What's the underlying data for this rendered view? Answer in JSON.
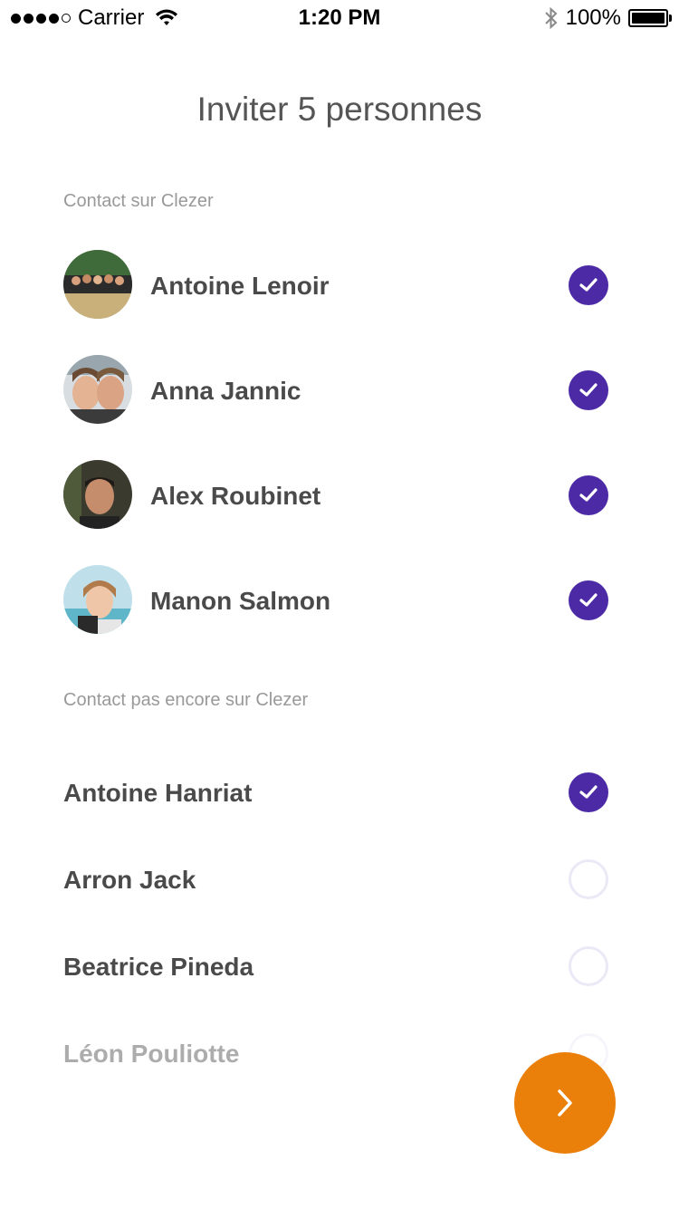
{
  "status": {
    "carrier": "Carrier",
    "time": "1:20 PM",
    "battery": "100%"
  },
  "title": "Inviter 5 personnes",
  "sections": {
    "on_app": "Contact sur Clezer",
    "not_on_app": "Contact pas encore sur Clezer"
  },
  "contacts_on_app": [
    {
      "name": "Antoine Lenoir",
      "selected": true
    },
    {
      "name": "Anna Jannic",
      "selected": true
    },
    {
      "name": "Alex Roubinet",
      "selected": true
    },
    {
      "name": "Manon Salmon",
      "selected": true
    }
  ],
  "contacts_not_on_app": [
    {
      "name": "Antoine Hanriat",
      "selected": true
    },
    {
      "name": "Arron Jack",
      "selected": false
    },
    {
      "name": "Beatrice Pineda",
      "selected": false
    },
    {
      "name": "Léon Pouliotte",
      "selected": false
    }
  ],
  "colors": {
    "accent": "#4c2aa6",
    "fab": "#ea7f0a"
  },
  "icons": {
    "fab": "chevron-right-icon",
    "check": "checkmark-icon"
  }
}
